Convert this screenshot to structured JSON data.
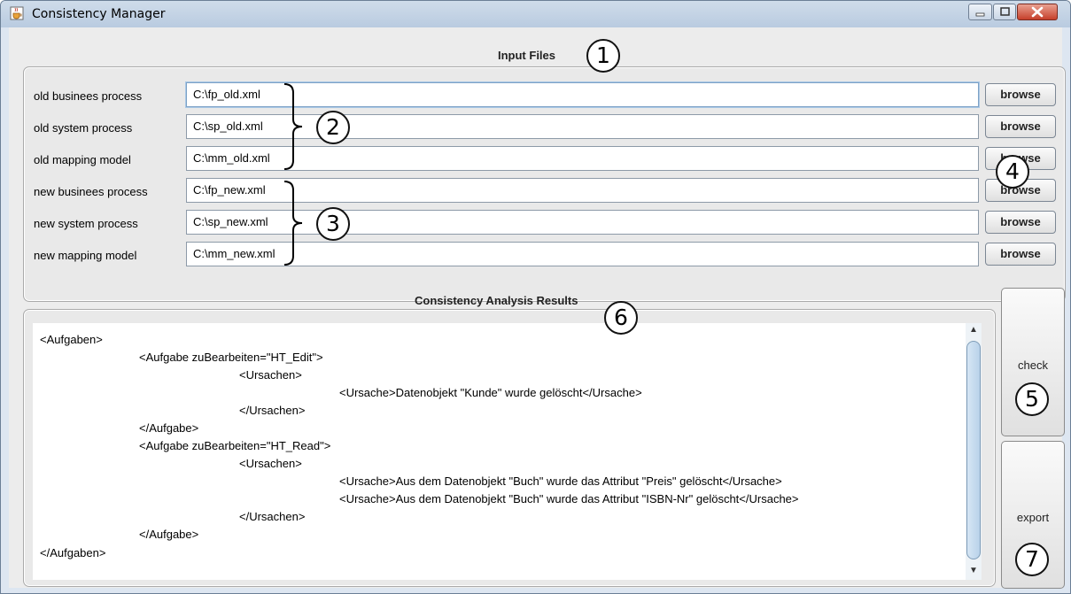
{
  "window": {
    "title": "Consistency Manager"
  },
  "input_files": {
    "title": "Input Files",
    "rows": [
      {
        "label": "old businees process",
        "value": "C:\\fp_old.xml",
        "button": "browse"
      },
      {
        "label": "old system process",
        "value": "C:\\sp_old.xml",
        "button": "browse"
      },
      {
        "label": "old mapping model",
        "value": "C:\\mm_old.xml",
        "button": "browse"
      },
      {
        "label": "new businees process",
        "value": "C:\\fp_new.xml",
        "button": "browse"
      },
      {
        "label": "new system process",
        "value": "C:\\sp_new.xml",
        "button": "browse"
      },
      {
        "label": "new mapping model",
        "value": "C:\\mm_new.xml",
        "button": "browse"
      }
    ]
  },
  "results": {
    "title": "Consistency Analysis Results",
    "lines": [
      "<Aufgaben>",
      "<Aufgabe zuBearbeiten=\"HT_Edit\">",
      "<Ursachen>",
      "<Ursache>Datenobjekt \"Kunde\" wurde gelöscht</Ursache>",
      "</Ursachen>",
      "</Aufgabe>",
      "<Aufgabe zuBearbeiten=\"HT_Read\">",
      "<Ursachen>",
      "<Ursache>Aus dem Datenobjekt \"Buch\" wurde das Attribut \"Preis\" gelöscht</Ursache>",
      "<Ursache>Aus dem Datenobjekt \"Buch\" wurde das Attribut \"ISBN-Nr\" gelöscht</Ursache>",
      "</Ursachen>",
      "</Aufgabe>",
      "</Aufgaben>"
    ]
  },
  "buttons": {
    "check": "check",
    "export": "export"
  },
  "callouts": {
    "c1": "1",
    "c2": "2",
    "c3": "3",
    "c4": "4",
    "c5": "5",
    "c6": "6",
    "c7": "7"
  },
  "icons": {
    "app": "java-cup-icon",
    "minimize": "minimize-icon",
    "maximize": "maximize-icon",
    "close": "close-icon",
    "scroll_up": "scroll-up-arrow-icon",
    "scroll_down": "scroll-down-arrow-icon"
  }
}
